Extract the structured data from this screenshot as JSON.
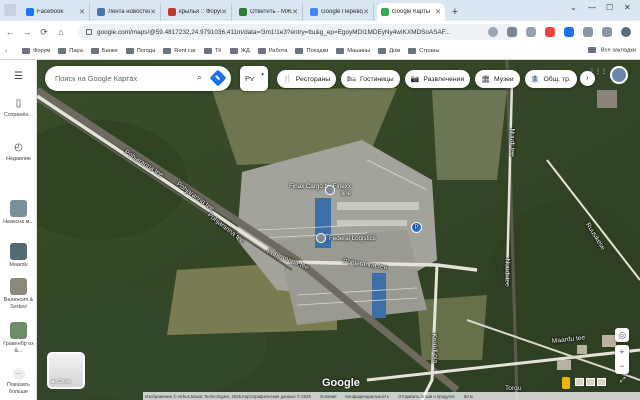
{
  "tabs": [
    {
      "title": "Facebook",
      "color": "#1877f2",
      "active": false
    },
    {
      "title": "Лента новостей",
      "color": "#4a76a8",
      "active": false
    },
    {
      "title": "крылья :: Форум...",
      "color": "#c0392b",
      "active": false
    },
    {
      "title": "Ответить - MЖЛ...",
      "color": "#2e7d32",
      "active": false
    },
    {
      "title": "Google Перевод...",
      "color": "#4285f4",
      "active": false
    },
    {
      "title": "Google Карты",
      "color": "#34a853",
      "active": true
    }
  ],
  "newtab": "+",
  "window_controls": [
    "⌄",
    "—",
    "☐",
    "✕"
  ],
  "nav": [
    "←",
    "→",
    "⟳",
    "⌂"
  ],
  "url": "google.com/maps/@59.4817232,24.9791036,411m/data=!3m1!1e3?entry=ttu&g_ep=EgoyMDI1MDEyNy4wIKXMDSoASAF...",
  "bookmarks": [
    "Форум",
    "Пара",
    "Банки",
    "Погода",
    "Rent car",
    "ТК",
    "ЖД",
    "Работа",
    "Поездки",
    "Машины",
    "Дом",
    "Страны"
  ],
  "all_bookmarks": "Все закладки",
  "sidebar": {
    "menu_icon": "☰",
    "saved": "Сохранён...",
    "recent": "Недавние",
    "places": [
      "Неиксна м...",
      "Maardu",
      "Валенсия & Sedavi",
      "Гравенбр ох &..."
    ],
    "show_more": "Показать больше",
    "more_icon": "···"
  },
  "search": {
    "placeholder": "Поиск на Google Картах",
    "icon": "⌕"
  },
  "lang": {
    "value": "Рv",
    "chevron": "▾"
  },
  "chips": [
    {
      "icon": "🍴",
      "label": "Рестораны"
    },
    {
      "icon": "🛏",
      "label": "Гостиницы"
    },
    {
      "icon": "📷",
      "label": "Развлечения"
    },
    {
      "icon": "🏛",
      "label": "Музеи"
    },
    {
      "icon": "🏦",
      "label": "Общ. тр."
    }
  ],
  "chip_next": "›",
  "apps_icon": "⋮⋮⋮",
  "map": {
    "poi_cargo": "Finax Cargo by Finexx line",
    "poi_parking": "P",
    "poi_logistics": "Federal Logistics",
    "road_labels": [
      "Pohjaranna tee",
      "Pohjaranna tee",
      "Pohjaranna tee",
      "Pohjaranna tee",
      "Pohjaranna tee",
      "Nuudi tee",
      "Nuudi tee",
      "Ruusikese",
      "Kroodi oja",
      "Maardu tee",
      "Torgu"
    ]
  },
  "layers_label": "Слои",
  "layers_icon": "◈",
  "logo": "Google",
  "footer": [
    "Изображения © Airbus,Maxar Technologies, 2025,Картографические данные © 2025",
    "Условия",
    "Конфиденциальность",
    "Отправить отзыв о продукте",
    "50 м"
  ],
  "controls": {
    "locate": "◎",
    "zoom_in": "+",
    "zoom_out": "−",
    "expand": "⤢"
  }
}
